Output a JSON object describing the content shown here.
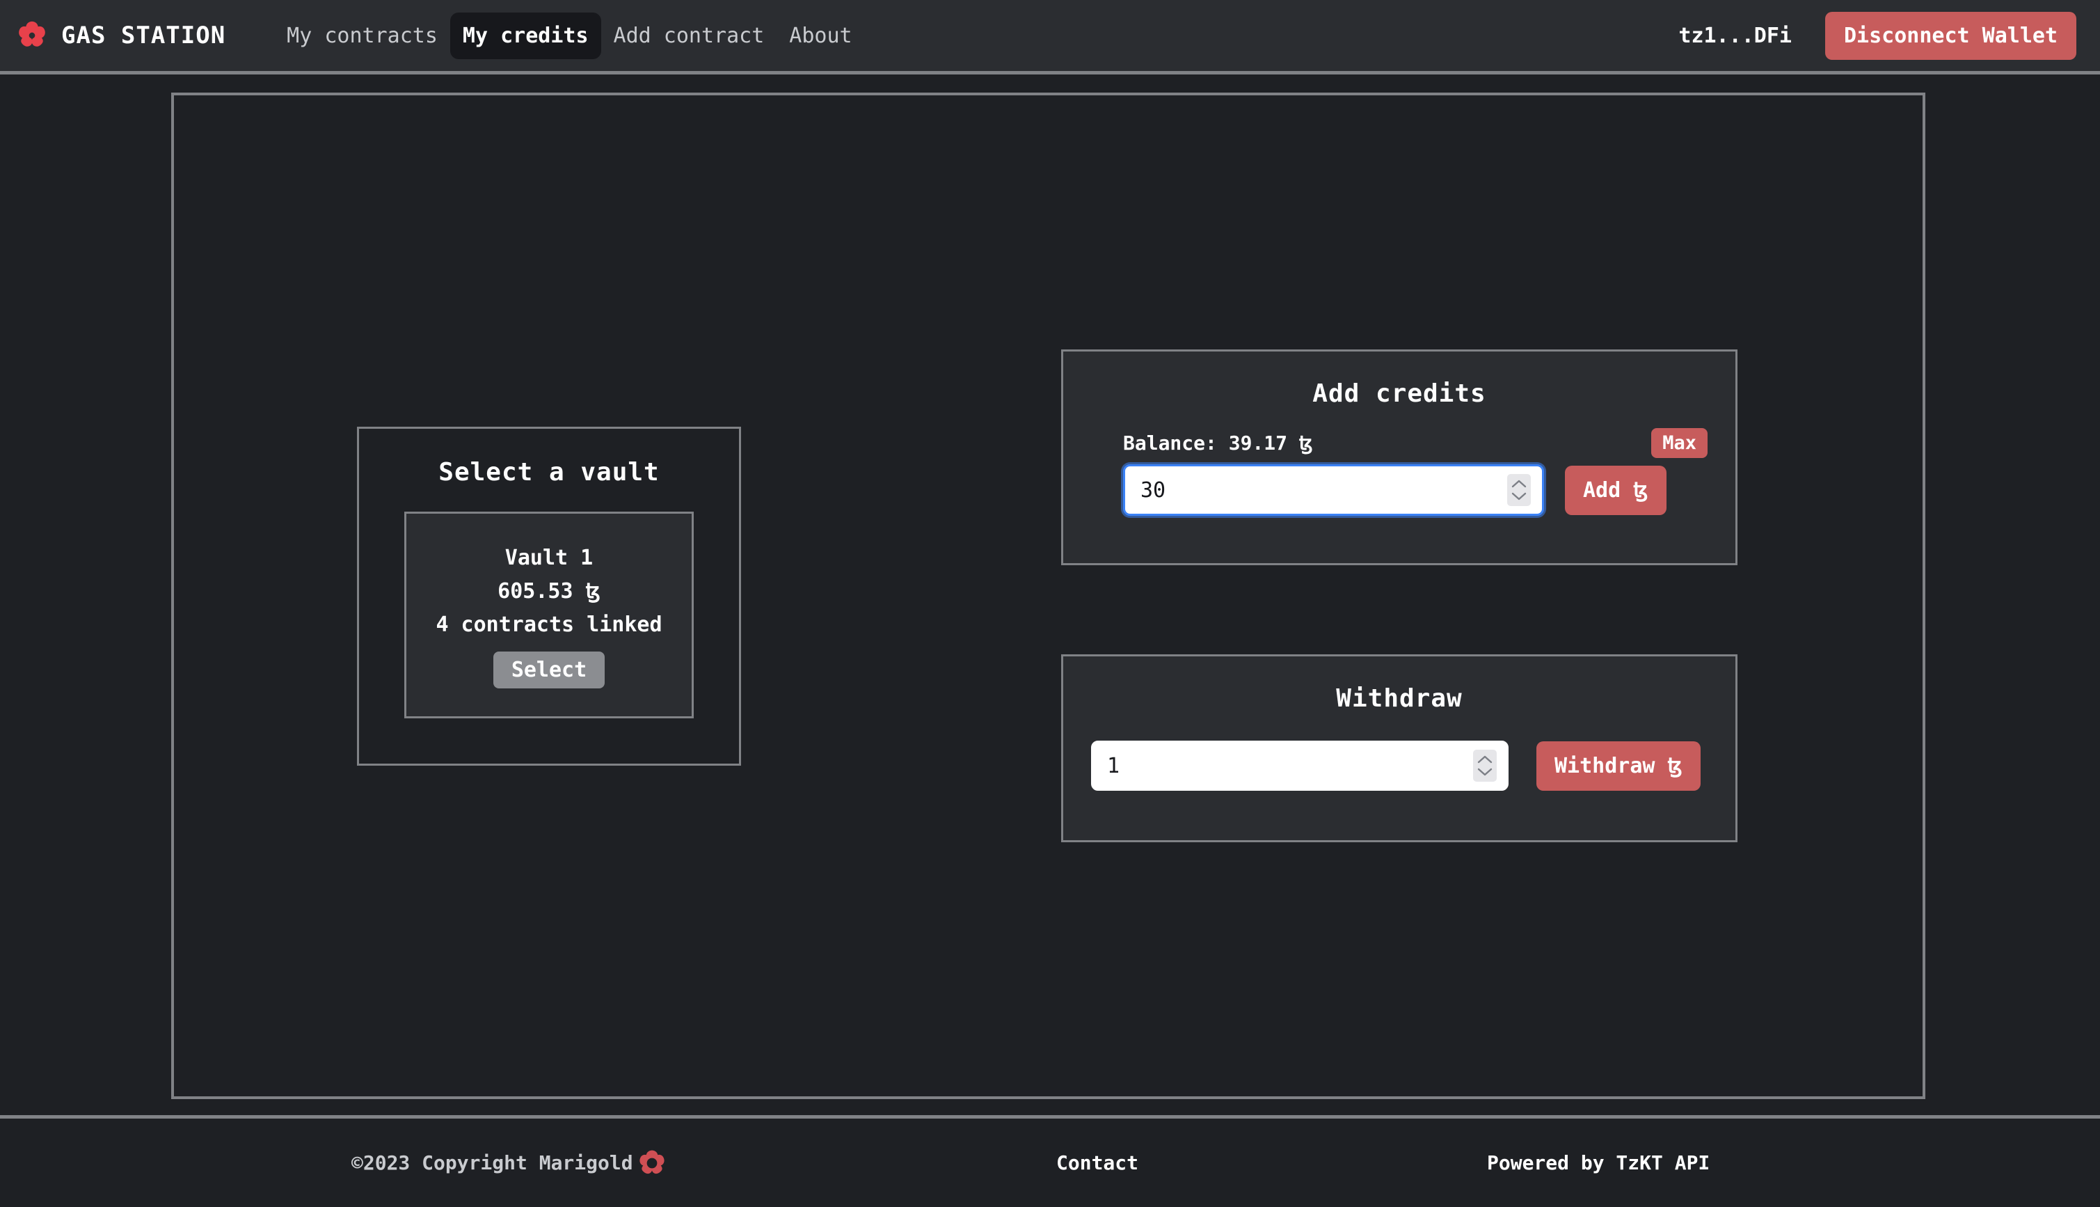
{
  "navbar": {
    "brand": {
      "logo_icon": "marigold-flower-icon",
      "title": "GAS STATION"
    },
    "links": [
      {
        "label": "My contracts",
        "active": false
      },
      {
        "label": "My credits",
        "active": true
      },
      {
        "label": "Add contract",
        "active": false
      },
      {
        "label": "About",
        "active": false
      }
    ],
    "wallet_address": "tz1...DFi",
    "disconnect_label": "Disconnect Wallet"
  },
  "vault_panel": {
    "title": "Select a vault",
    "vault": {
      "name": "Vault 1",
      "balance": "605.53 ꜩ",
      "contracts": "4 contracts linked",
      "select_label": "Select"
    }
  },
  "add_credits": {
    "title": "Add credits",
    "balance_label": "Balance: 39.17 ꜩ",
    "max_label": "Max",
    "amount_value": "30",
    "amount_placeholder": "0",
    "add_label": "Add ꜩ"
  },
  "withdraw": {
    "title": "Withdraw",
    "amount_value": "1",
    "amount_placeholder": "0",
    "withdraw_label": "Withdraw ꜩ"
  },
  "footer": {
    "copyright": "©2023 Copyright Marigold",
    "logo_icon": "marigold-flower-icon",
    "contact_label": "Contact",
    "powered_label": "Powered by TzKT API"
  },
  "colors": {
    "accent_red": "#c75c5c",
    "navbar_bg": "#2b2d31",
    "page_bg": "#1e2024",
    "border_gray": "#808286",
    "focus_blue": "#3b82f6",
    "select_gray": "#8b8d91"
  }
}
